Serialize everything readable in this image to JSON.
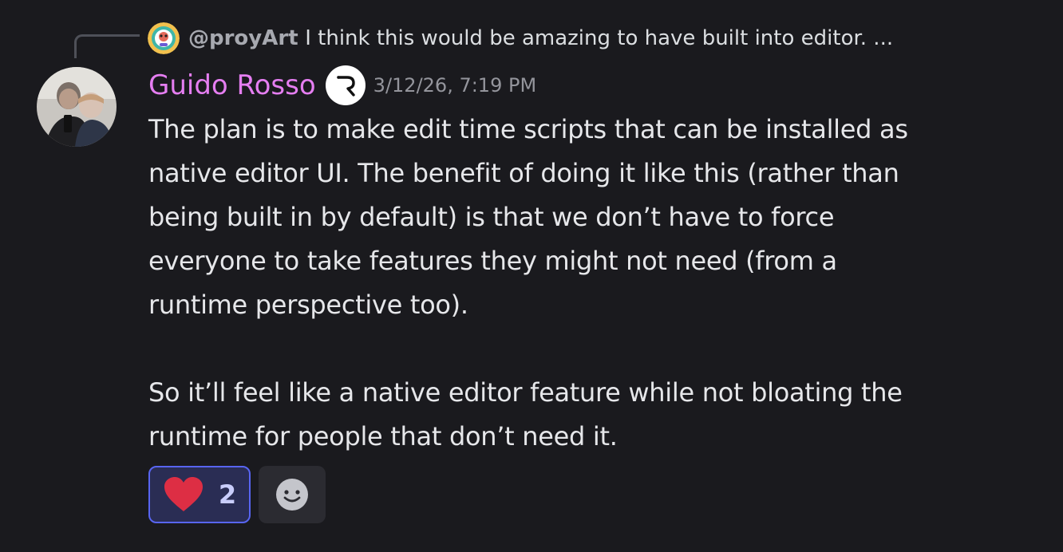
{
  "reply": {
    "author": "@proyArt",
    "text": "I think this would be amazing to have built into editor. ..."
  },
  "message": {
    "author": "Guido Rosso",
    "timestamp": "3/12/26, 7:19 PM",
    "paragraphs": [
      [
        "The plan is to make edit time scripts that can be installed as",
        "native editor UI. The benefit of doing it like this (rather than",
        "being built in by default) is that we don’t have to force",
        "everyone to take features they might not need (from a",
        "runtime perspective too)."
      ],
      [
        "So it’ll feel like a native editor feature while not bloating the",
        "runtime for people that don’t need it."
      ]
    ]
  },
  "reactions": [
    {
      "emoji": "heart-icon",
      "count": "2",
      "active": true
    }
  ],
  "colors": {
    "background": "#1a1a1e",
    "username": "#e57ef1",
    "reaction_border": "#5865f2",
    "heart": "#dd2e44"
  }
}
